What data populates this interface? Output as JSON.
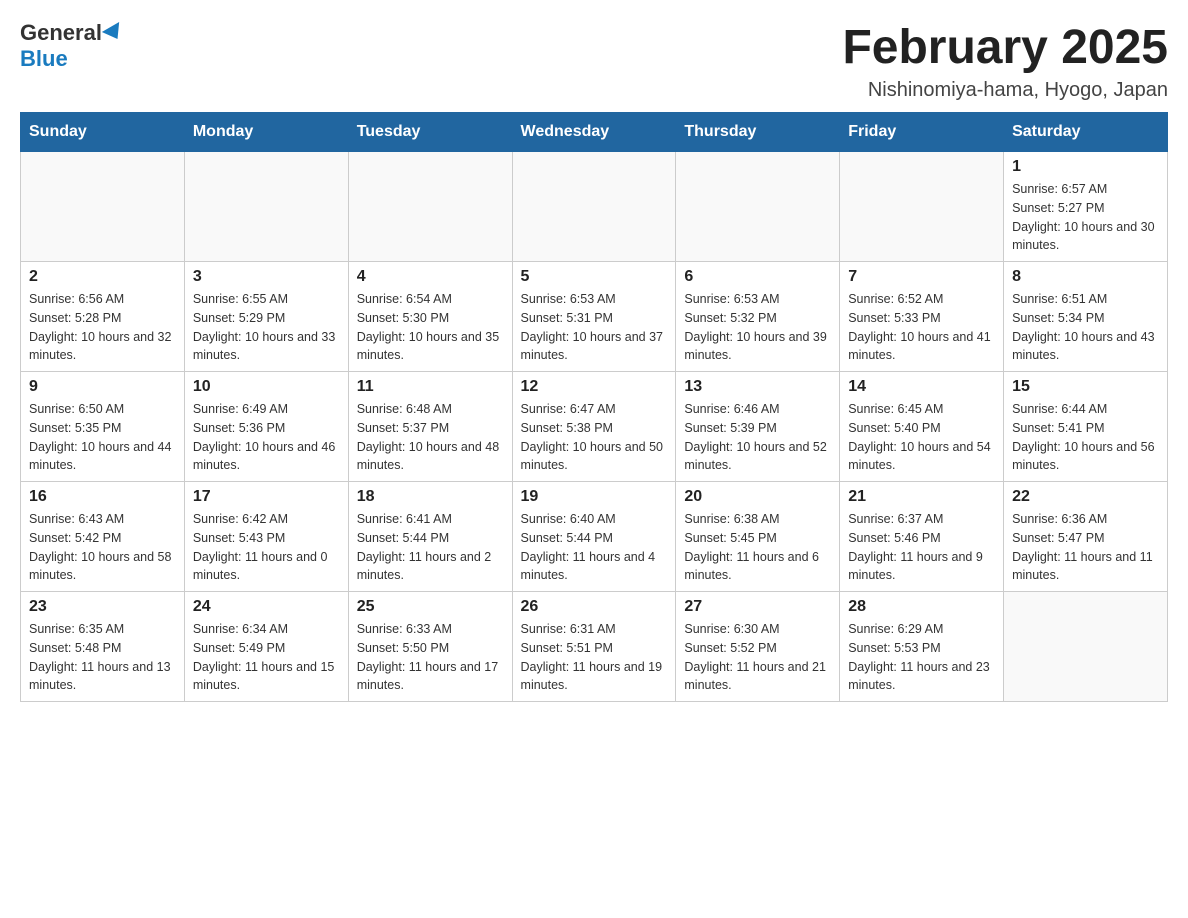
{
  "logo": {
    "general": "General",
    "blue": "Blue"
  },
  "title": "February 2025",
  "location": "Nishinomiya-hama, Hyogo, Japan",
  "weekdays": [
    "Sunday",
    "Monday",
    "Tuesday",
    "Wednesday",
    "Thursday",
    "Friday",
    "Saturday"
  ],
  "weeks": [
    [
      {
        "day": "",
        "info": ""
      },
      {
        "day": "",
        "info": ""
      },
      {
        "day": "",
        "info": ""
      },
      {
        "day": "",
        "info": ""
      },
      {
        "day": "",
        "info": ""
      },
      {
        "day": "",
        "info": ""
      },
      {
        "day": "1",
        "info": "Sunrise: 6:57 AM\nSunset: 5:27 PM\nDaylight: 10 hours and 30 minutes."
      }
    ],
    [
      {
        "day": "2",
        "info": "Sunrise: 6:56 AM\nSunset: 5:28 PM\nDaylight: 10 hours and 32 minutes."
      },
      {
        "day": "3",
        "info": "Sunrise: 6:55 AM\nSunset: 5:29 PM\nDaylight: 10 hours and 33 minutes."
      },
      {
        "day": "4",
        "info": "Sunrise: 6:54 AM\nSunset: 5:30 PM\nDaylight: 10 hours and 35 minutes."
      },
      {
        "day": "5",
        "info": "Sunrise: 6:53 AM\nSunset: 5:31 PM\nDaylight: 10 hours and 37 minutes."
      },
      {
        "day": "6",
        "info": "Sunrise: 6:53 AM\nSunset: 5:32 PM\nDaylight: 10 hours and 39 minutes."
      },
      {
        "day": "7",
        "info": "Sunrise: 6:52 AM\nSunset: 5:33 PM\nDaylight: 10 hours and 41 minutes."
      },
      {
        "day": "8",
        "info": "Sunrise: 6:51 AM\nSunset: 5:34 PM\nDaylight: 10 hours and 43 minutes."
      }
    ],
    [
      {
        "day": "9",
        "info": "Sunrise: 6:50 AM\nSunset: 5:35 PM\nDaylight: 10 hours and 44 minutes."
      },
      {
        "day": "10",
        "info": "Sunrise: 6:49 AM\nSunset: 5:36 PM\nDaylight: 10 hours and 46 minutes."
      },
      {
        "day": "11",
        "info": "Sunrise: 6:48 AM\nSunset: 5:37 PM\nDaylight: 10 hours and 48 minutes."
      },
      {
        "day": "12",
        "info": "Sunrise: 6:47 AM\nSunset: 5:38 PM\nDaylight: 10 hours and 50 minutes."
      },
      {
        "day": "13",
        "info": "Sunrise: 6:46 AM\nSunset: 5:39 PM\nDaylight: 10 hours and 52 minutes."
      },
      {
        "day": "14",
        "info": "Sunrise: 6:45 AM\nSunset: 5:40 PM\nDaylight: 10 hours and 54 minutes."
      },
      {
        "day": "15",
        "info": "Sunrise: 6:44 AM\nSunset: 5:41 PM\nDaylight: 10 hours and 56 minutes."
      }
    ],
    [
      {
        "day": "16",
        "info": "Sunrise: 6:43 AM\nSunset: 5:42 PM\nDaylight: 10 hours and 58 minutes."
      },
      {
        "day": "17",
        "info": "Sunrise: 6:42 AM\nSunset: 5:43 PM\nDaylight: 11 hours and 0 minutes."
      },
      {
        "day": "18",
        "info": "Sunrise: 6:41 AM\nSunset: 5:44 PM\nDaylight: 11 hours and 2 minutes."
      },
      {
        "day": "19",
        "info": "Sunrise: 6:40 AM\nSunset: 5:44 PM\nDaylight: 11 hours and 4 minutes."
      },
      {
        "day": "20",
        "info": "Sunrise: 6:38 AM\nSunset: 5:45 PM\nDaylight: 11 hours and 6 minutes."
      },
      {
        "day": "21",
        "info": "Sunrise: 6:37 AM\nSunset: 5:46 PM\nDaylight: 11 hours and 9 minutes."
      },
      {
        "day": "22",
        "info": "Sunrise: 6:36 AM\nSunset: 5:47 PM\nDaylight: 11 hours and 11 minutes."
      }
    ],
    [
      {
        "day": "23",
        "info": "Sunrise: 6:35 AM\nSunset: 5:48 PM\nDaylight: 11 hours and 13 minutes."
      },
      {
        "day": "24",
        "info": "Sunrise: 6:34 AM\nSunset: 5:49 PM\nDaylight: 11 hours and 15 minutes."
      },
      {
        "day": "25",
        "info": "Sunrise: 6:33 AM\nSunset: 5:50 PM\nDaylight: 11 hours and 17 minutes."
      },
      {
        "day": "26",
        "info": "Sunrise: 6:31 AM\nSunset: 5:51 PM\nDaylight: 11 hours and 19 minutes."
      },
      {
        "day": "27",
        "info": "Sunrise: 6:30 AM\nSunset: 5:52 PM\nDaylight: 11 hours and 21 minutes."
      },
      {
        "day": "28",
        "info": "Sunrise: 6:29 AM\nSunset: 5:53 PM\nDaylight: 11 hours and 23 minutes."
      },
      {
        "day": "",
        "info": ""
      }
    ]
  ]
}
